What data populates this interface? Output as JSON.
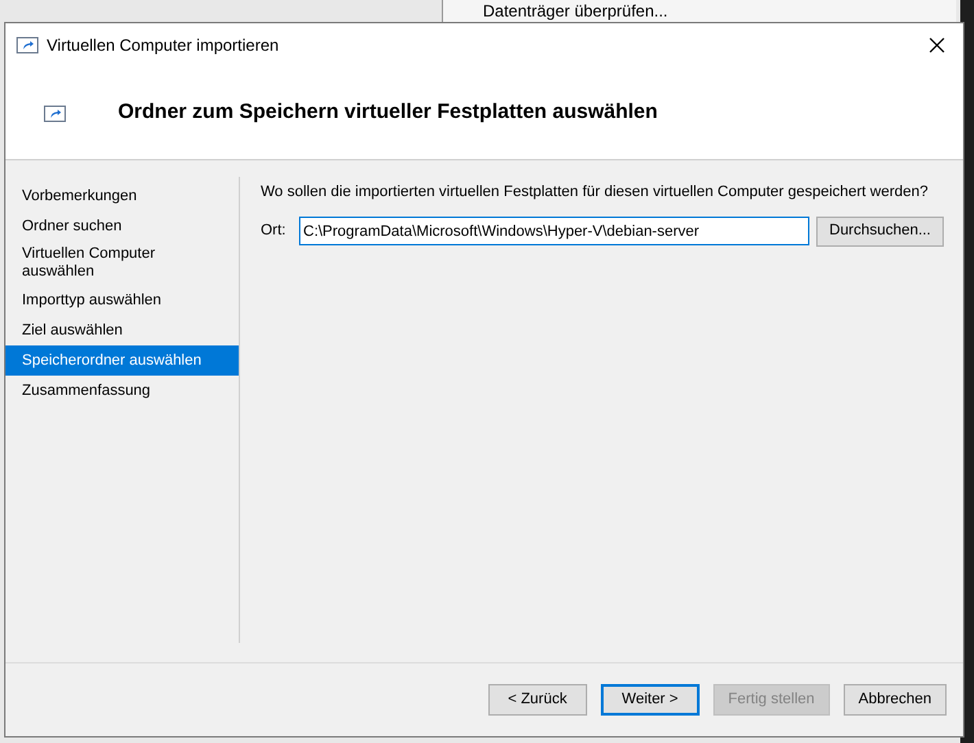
{
  "background": {
    "menu_item": "Datenträger überprüfen..."
  },
  "window": {
    "title": "Virtuellen Computer importieren"
  },
  "header": {
    "title": "Ordner zum Speichern virtueller Festplatten auswählen"
  },
  "steps": [
    {
      "label": "Vorbemerkungen",
      "selected": false
    },
    {
      "label": "Ordner suchen",
      "selected": false
    },
    {
      "label": "Virtuellen Computer auswählen",
      "selected": false
    },
    {
      "label": "Importtyp auswählen",
      "selected": false
    },
    {
      "label": "Ziel auswählen",
      "selected": false
    },
    {
      "label": "Speicherordner auswählen",
      "selected": true
    },
    {
      "label": "Zusammenfassung",
      "selected": false
    }
  ],
  "content": {
    "question": "Wo sollen die importierten virtuellen Festplatten für diesen virtuellen Computer gespeichert werden?",
    "location_label": "Ort:",
    "location_value": "C:\\ProgramData\\Microsoft\\Windows\\Hyper-V\\debian-server",
    "browse_button": "Durchsuchen..."
  },
  "buttons": [
    {
      "label": "< Zurück",
      "default": false,
      "disabled": false
    },
    {
      "label": "Weiter >",
      "default": true,
      "disabled": false
    },
    {
      "label": "Fertig stellen",
      "default": false,
      "disabled": true
    },
    {
      "label": "Abbrechen",
      "default": false,
      "disabled": false
    }
  ]
}
